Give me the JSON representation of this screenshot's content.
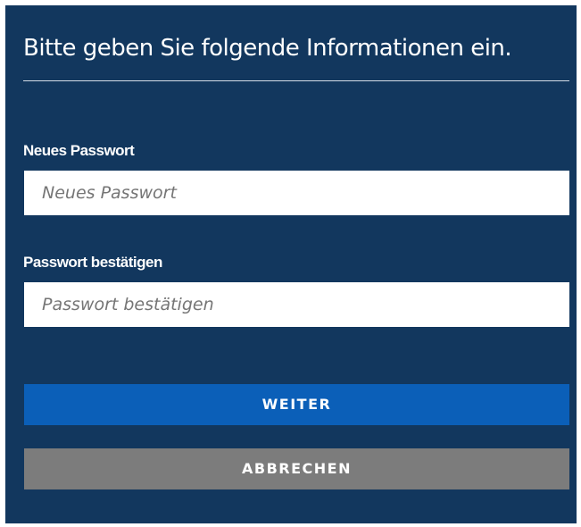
{
  "form": {
    "title": "Bitte geben Sie folgende Informationen ein.",
    "fields": [
      {
        "label": "Neues Passwort",
        "placeholder": "Neues Passwort",
        "value": ""
      },
      {
        "label": "Passwort bestätigen",
        "placeholder": "Passwort bestätigen",
        "value": ""
      }
    ],
    "buttons": {
      "continue_label": "WEITER",
      "cancel_label": "ABBRECHEN"
    }
  },
  "colors": {
    "panel_background": "#12375e",
    "primary_button": "#0b5fb8",
    "secondary_button": "#7c7c7c"
  }
}
